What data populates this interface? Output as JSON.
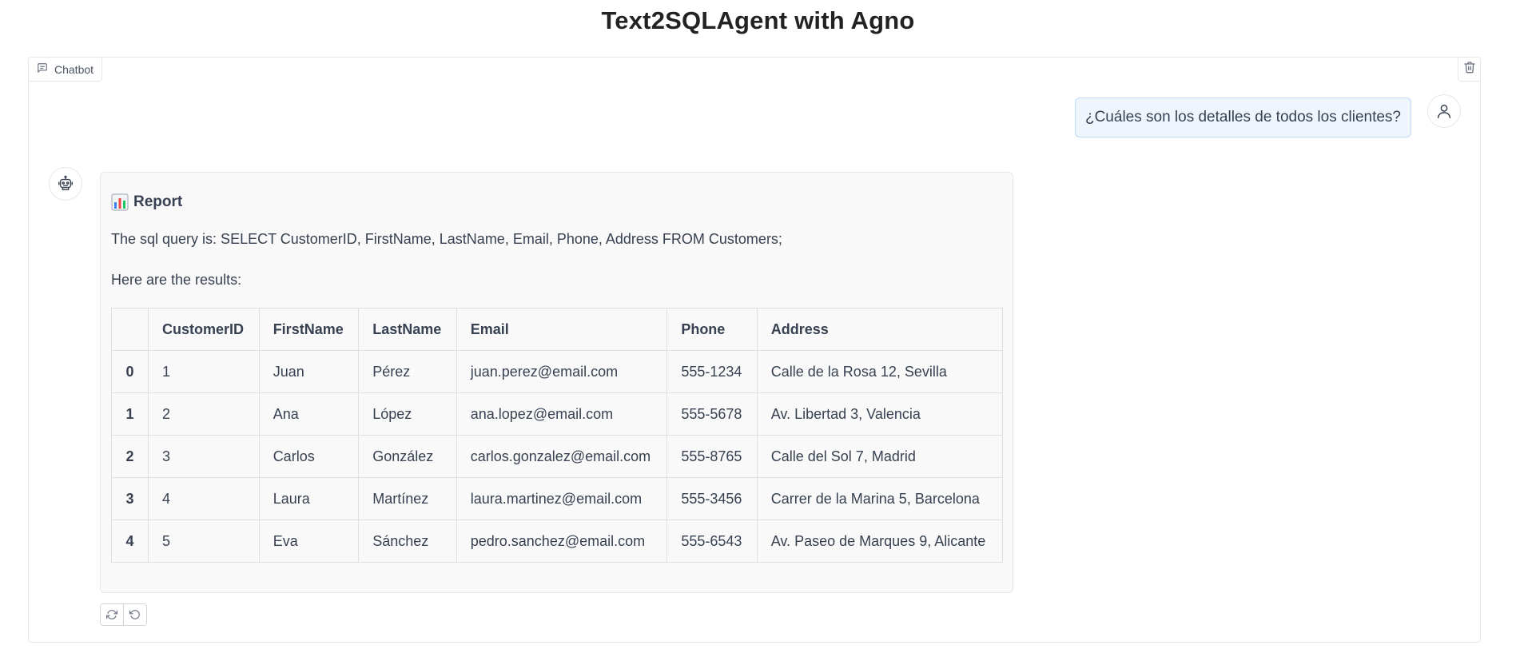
{
  "header": {
    "title": "Text2SQLAgent with Agno"
  },
  "chatbot": {
    "label": "Chatbot",
    "label_icon": "chat-bubble-icon",
    "clear_icon": "trash-icon"
  },
  "user_message": {
    "text": "¿Cuáles son los detalles de todos los clientes?",
    "avatar_icon": "user-icon"
  },
  "bot_message": {
    "avatar_icon": "robot-icon",
    "heading_icon": "bar-chart-icon",
    "heading": "Report",
    "sql_line": "The sql query is: SELECT CustomerID, FirstName, LastName, Email, Phone, Address FROM Customers;",
    "results_intro": "Here are the results:",
    "table": {
      "headers": [
        "",
        "CustomerID",
        "FirstName",
        "LastName",
        "Email",
        "Phone",
        "Address"
      ],
      "rows": [
        [
          "0",
          "1",
          "Juan",
          "Pérez",
          "juan.perez@email.com",
          "555-1234",
          "Calle de la Rosa 12, Sevilla"
        ],
        [
          "1",
          "2",
          "Ana",
          "López",
          "ana.lopez@email.com",
          "555-5678",
          "Av. Libertad 3, Valencia"
        ],
        [
          "2",
          "3",
          "Carlos",
          "González",
          "carlos.gonzalez@email.com",
          "555-8765",
          "Calle del Sol 7, Madrid"
        ],
        [
          "3",
          "4",
          "Laura",
          "Martínez",
          "laura.martinez@email.com",
          "555-3456",
          "Carrer de la Marina 5, Barcelona"
        ],
        [
          "4",
          "5",
          "Eva",
          "Sánchez",
          "pedro.sanchez@email.com",
          "555-6543",
          "Av. Paseo de Marques 9, Alicante"
        ]
      ]
    }
  },
  "actions": [
    {
      "icon": "retry-icon"
    },
    {
      "icon": "undo-icon"
    }
  ],
  "colors": {
    "user_bubble_bg": "#eef5fd",
    "user_bubble_border": "#bfdbf7",
    "bot_bubble_bg": "#f9f9f9"
  }
}
